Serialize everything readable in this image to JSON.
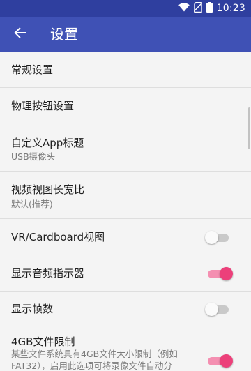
{
  "status_bar": {
    "time": "10:23",
    "icons": [
      "wifi-icon",
      "no-sim-icon",
      "battery-icon"
    ]
  },
  "app_bar": {
    "title": "设置",
    "back_icon": "arrow-back-icon"
  },
  "colors": {
    "primary": "#3f51b5",
    "status_bar": "#2f3f9f",
    "accent": "#ec407a"
  },
  "settings": [
    {
      "title": "常规设置"
    },
    {
      "title": "物理按钮设置"
    },
    {
      "title": "自定义App标题",
      "subtitle": "USB摄像头"
    },
    {
      "title": "视频视图长宽比",
      "subtitle": "默认(推荐)"
    },
    {
      "title": "VR/Cardboard视图",
      "toggle": false
    },
    {
      "title": "显示音频指示器",
      "toggle": true
    },
    {
      "title": "显示帧数",
      "toggle": false
    },
    {
      "title": "4GB文件限制",
      "subtitle": "某些文件系统具有4GB文件大小限制（例如FAT32），启用此选项可将录像文件自动分",
      "toggle": true
    }
  ]
}
